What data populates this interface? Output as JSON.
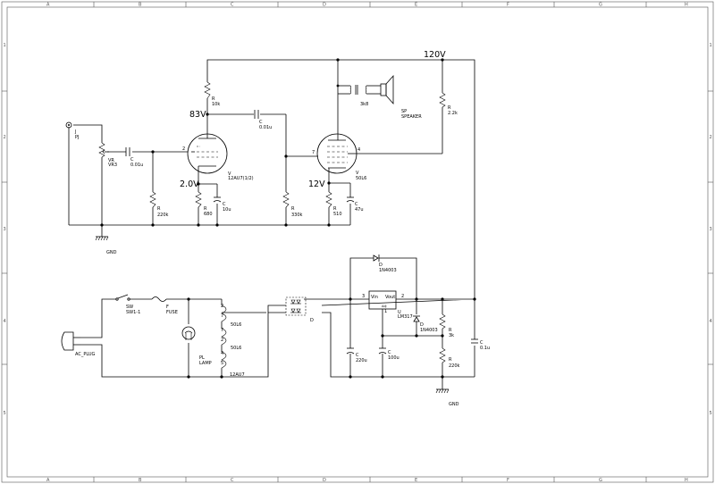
{
  "grid": {
    "columns": [
      "A",
      "B",
      "C",
      "D",
      "E",
      "F",
      "G",
      "H"
    ],
    "rows": [
      "1",
      "2",
      "3",
      "4",
      "5"
    ]
  },
  "voltages": {
    "v120": "120V",
    "v83": "83V",
    "v2": "2.0V",
    "v12": "12V"
  },
  "components": {
    "jack": {
      "ref": "J",
      "value": "PJ"
    },
    "vr": {
      "ref": "VR",
      "value": "VR3"
    },
    "c_in": {
      "ref": "C",
      "value": "0.01u"
    },
    "r_grid": {
      "ref": "R",
      "value": "220k"
    },
    "r_plate1": {
      "ref": "R",
      "value": "10k"
    },
    "v1": {
      "ref": "V",
      "value": "12AU7(1/2)"
    },
    "r_k1": {
      "ref": "R",
      "value": "680"
    },
    "c_k1": {
      "ref": "C",
      "value": "10u"
    },
    "c_cpl": {
      "ref": "C",
      "value": "0.01u"
    },
    "r_g2": {
      "ref": "R",
      "value": "330k"
    },
    "v2": {
      "ref": "V",
      "value": "50L6"
    },
    "r_k2": {
      "ref": "R",
      "value": "510"
    },
    "c_k2": {
      "ref": "C",
      "value": "47u"
    },
    "xfmr": {
      "value": "3k8"
    },
    "speaker": {
      "ref": "SP",
      "value": "SPEAKER"
    },
    "r_screen": {
      "ref": "R",
      "value": "2.2k"
    },
    "ground_top": {
      "label": "GND"
    },
    "ac_plug": {
      "label": "AC_PLUG"
    },
    "sw": {
      "ref": "SW",
      "value": "SW1-1"
    },
    "fuse": {
      "ref": "F",
      "value": "FUSE"
    },
    "lamp": {
      "ref": "PL",
      "value": "LAMP"
    },
    "heaters": {
      "h1": "50L6",
      "h2": "50L6",
      "h3": "12AU7",
      "pins": [
        "2",
        "7",
        "3",
        "4",
        "5"
      ]
    },
    "bridge": {
      "ref": "D"
    },
    "d_top": {
      "ref": "D",
      "value": "1N4003"
    },
    "reg": {
      "ref": "U",
      "value": "LM317",
      "vin": "Vin",
      "vout": "Vout",
      "adj": "Adj",
      "pin_in": "3",
      "pin_out": "2",
      "pin_adj": "1"
    },
    "d_mid": {
      "ref": "D",
      "value": "1N4003"
    },
    "c_220": {
      "ref": "C",
      "value": "220u"
    },
    "c_100": {
      "ref": "C",
      "value": "100u"
    },
    "r_3k": {
      "ref": "R",
      "value": "3k"
    },
    "r_220k": {
      "ref": "R",
      "value": "220k"
    },
    "c_01": {
      "ref": "C",
      "value": "0.1u"
    },
    "ground_bot": {
      "label": "GND"
    }
  }
}
